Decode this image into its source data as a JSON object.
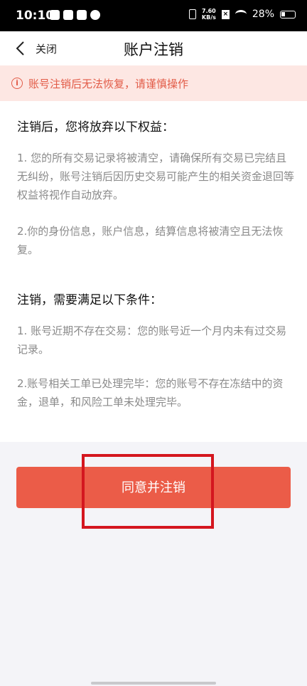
{
  "statusbar": {
    "time": "10:10",
    "speed_top": "7.60",
    "speed_bottom": "KB/s",
    "battery": "28%"
  },
  "navbar": {
    "close_label": "关闭",
    "title": "账户注销"
  },
  "warning": {
    "text": "账号注销后无法恢复，请谨慎操作"
  },
  "sections": [
    {
      "heading": "注销后，您将放弃以下权益：",
      "items": [
        "1. 您的所有交易记录将被清空，请确保所有交易已完结且无纠纷，账号注销后因历史交易可能产生的相关资金退回等权益将视作自动放弃。",
        "2.你的身份信息，账户信息，结算信息将被清空且无法恢复。"
      ]
    },
    {
      "heading": "注销，需要满足以下条件：",
      "items": [
        "1. 账号近期不存在交易：您的账号近一个月内未有过交易记录。",
        "2.账号相关工单已处理完毕：您的账号不存在冻结中的资金，退单，和风险工单未处理完毕。"
      ]
    }
  ],
  "action": {
    "agree_label": "同意并注销"
  },
  "colors": {
    "accent": "#eb5c48",
    "warning_bg": "#fde7e3",
    "highlight": "#d4161f"
  }
}
